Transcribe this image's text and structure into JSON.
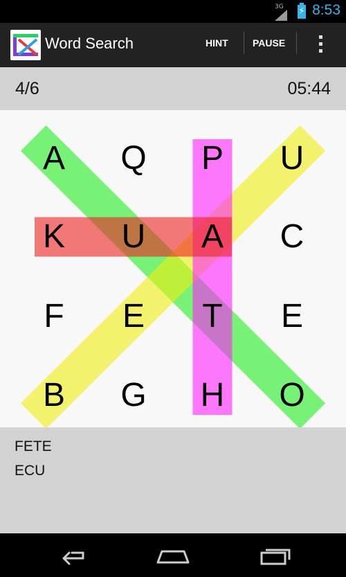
{
  "status_bar": {
    "network": "3G",
    "time": "8:53"
  },
  "action_bar": {
    "title": "Word Search",
    "hint_label": "HINT",
    "pause_label": "PAUSE"
  },
  "game": {
    "progress": "4/6",
    "timer": "05:44",
    "grid": [
      [
        "A",
        "Q",
        "P",
        "U"
      ],
      [
        "K",
        "U",
        "A",
        "C"
      ],
      [
        "F",
        "E",
        "T",
        "E"
      ],
      [
        "B",
        "G",
        "H",
        "O"
      ]
    ],
    "found_words": [
      {
        "color": "#22ee22",
        "cells": [
          [
            0,
            0
          ],
          [
            3,
            3
          ]
        ]
      },
      {
        "color": "#eeee11",
        "cells": [
          [
            3,
            0
          ],
          [
            0,
            3
          ]
        ]
      },
      {
        "color": "#ff22ff",
        "cells": [
          [
            0,
            2
          ],
          [
            3,
            2
          ]
        ]
      },
      {
        "color": "#ee2222",
        "cells": [
          [
            1,
            0
          ],
          [
            1,
            2
          ]
        ]
      }
    ],
    "words_left": [
      "FETE",
      "ECU"
    ]
  },
  "colors": {
    "status_accent": "#33b5e5",
    "action_bar": "#222222",
    "panel": "#d2d2d2",
    "grid_background": "#f8f8f8"
  }
}
